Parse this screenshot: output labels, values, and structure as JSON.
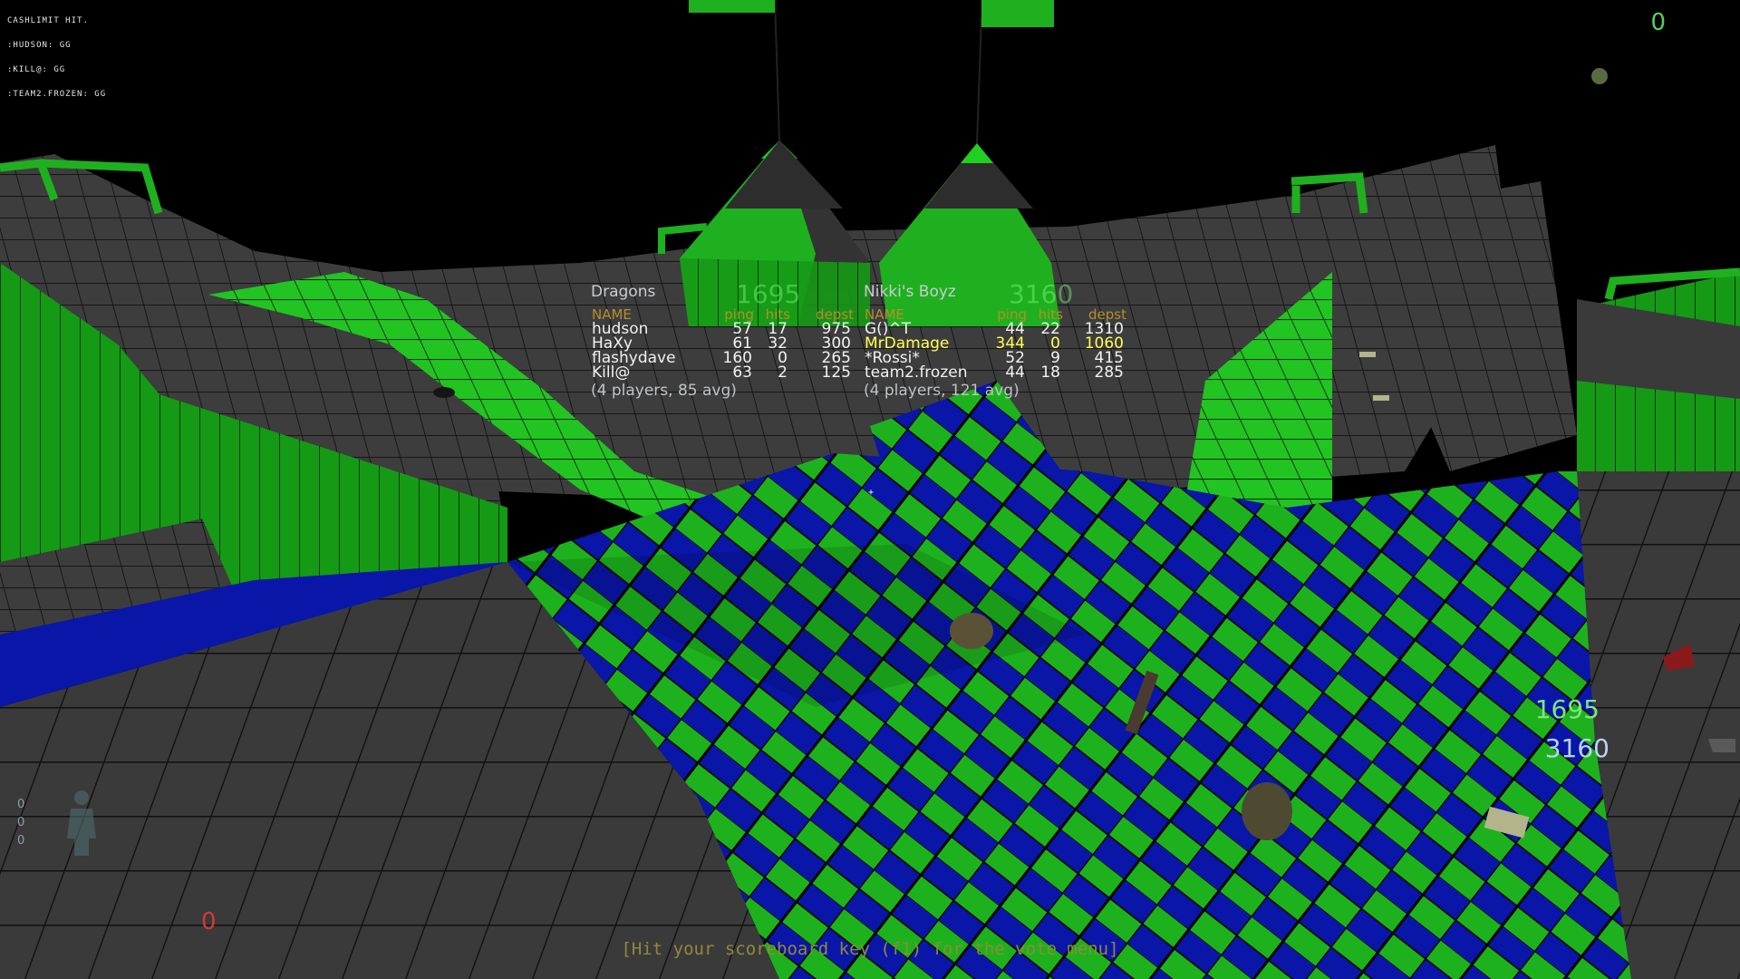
{
  "console": {
    "lines": [
      "CASHLIMIT HIT.",
      ":HUDSON: GG",
      ":KILL@: GG",
      ":TEAM2.FROZEN: GG"
    ]
  },
  "hud": {
    "ammo_top": "0",
    "team1_score": "1695",
    "team2_score": "3160",
    "health": "0",
    "stats": [
      "0",
      "0",
      "0"
    ],
    "vote_hint": "[Hit your scoreboard key (f1) for the vote menu]"
  },
  "scoreboard": {
    "columns": {
      "name": "NAME",
      "ping": "ping",
      "hits": "hits",
      "depst": "depst"
    },
    "teams": [
      {
        "name": "Dragons",
        "score": "1695",
        "players": [
          {
            "name": "hudson",
            "ping": "57",
            "hits": "17",
            "depst": "975"
          },
          {
            "name": "HaXy",
            "ping": "61",
            "hits": "32",
            "depst": "300"
          },
          {
            "name": "flashydave",
            "ping": "160",
            "hits": "0",
            "depst": "265"
          },
          {
            "name": "Kill@",
            "ping": "63",
            "hits": "2",
            "depst": "125"
          }
        ],
        "footer": "(4 players, 85 avg)"
      },
      {
        "name": "Nikki's Boyz",
        "score": "3160",
        "players": [
          {
            "name": "G()^T",
            "ping": "44",
            "hits": "22",
            "depst": "1310"
          },
          {
            "name": "MrDamage",
            "ping": "344",
            "hits": "0",
            "depst": "1060"
          },
          {
            "name": "*Rossi*",
            "ping": "52",
            "hits": "9",
            "depst": "415"
          },
          {
            "name": "team2.frozen",
            "ping": "44",
            "hits": "18",
            "depst": "285"
          }
        ],
        "footer": "(4 players, 121 avg)"
      }
    ]
  },
  "colors": {
    "sky": "#000000",
    "terrain_gray": "#3b3b3b",
    "terrain_green": "#1fb01f",
    "terrain_blue": "#0a1ab0",
    "grid_line": "#101010",
    "header_gold": "#b58e2a",
    "highlight_yellow": "#ffff55"
  },
  "icons": [
    "grenade-icon",
    "player-silhouette-icon",
    "crosshair-icon",
    "weapon-icon"
  ]
}
